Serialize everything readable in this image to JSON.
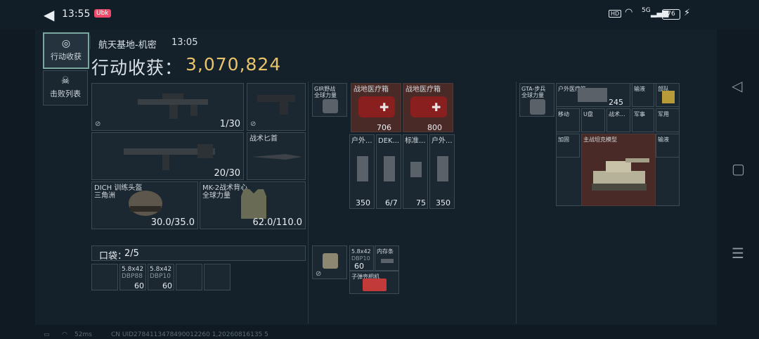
{
  "status_bar": {
    "time": "13:55",
    "app_badge": "Ubk",
    "network": "5G",
    "hd": "HD",
    "battery": "76"
  },
  "tabs": [
    {
      "label": "行动收获"
    },
    {
      "label": "击败列表"
    }
  ],
  "header": {
    "map": "航天基地-机密",
    "time": "13:05",
    "harvest_label": "行动收获：",
    "harvest_value": "3,070,824"
  },
  "weapons": {
    "primary_ammo": "1/30",
    "secondary_ammo": "20/30",
    "knife_label": "战术匕首",
    "helmet": {
      "name": "DICH 训练头盔",
      "sub": "三角洲",
      "durability": "30.0/35.0"
    },
    "vest": {
      "name": "MK-2战术背心",
      "sub": "全球力量",
      "durability": "62.0/110.0"
    }
  },
  "pockets": {
    "label": "口袋：",
    "count": "2/5",
    "items": [
      {
        "label": "5.8x42",
        "sub": "DBP88",
        "count": "60"
      },
      {
        "label": "5.8x42",
        "sub": "DBP10",
        "count": "60"
      }
    ]
  },
  "backpack": {
    "small_item": {
      "label": "GIR野战",
      "sub": "全球力量"
    },
    "medkits": [
      {
        "label": "战地医疗箱",
        "count": "706"
      },
      {
        "label": "战地医疗箱",
        "count": "800"
      }
    ],
    "row2": [
      {
        "label": "户外...",
        "count": "350"
      },
      {
        "label": "DEK...",
        "count": "6/7"
      },
      {
        "label": "标准...",
        "count": "75"
      },
      {
        "label": "户外...",
        "count": "350"
      }
    ]
  },
  "chest_rig": {
    "items": [
      {
        "label": "5.8x42",
        "sub": "DBP10",
        "count": "60"
      },
      {
        "label": "内存条"
      },
      {
        "label": "子弹壳相机"
      }
    ]
  },
  "safe_box": {
    "container": {
      "label": "GTA-步兵",
      "sub": "全球力量"
    },
    "items": [
      {
        "label": "户外医疗箱",
        "count": "245"
      },
      {
        "label": "输液"
      },
      {
        "label": "部队"
      },
      {
        "label": "移动"
      },
      {
        "label": "U盘"
      },
      {
        "label": "战术..."
      },
      {
        "label": "军事"
      },
      {
        "label": "军用"
      },
      {
        "label": "加固"
      },
      {
        "label": "主战坦克模型"
      },
      {
        "label": "输液"
      }
    ]
  },
  "footer": {
    "ping": "52ms",
    "uid": "CN UID2784113478490012260 1,20260816135 5"
  },
  "nav": {
    "back": "◁",
    "home": "▢",
    "menu": "☰"
  }
}
